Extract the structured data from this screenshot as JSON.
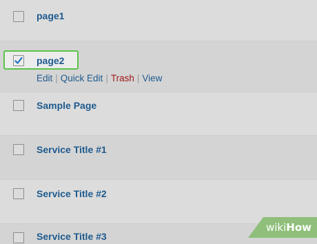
{
  "rows": [
    {
      "title": "page1",
      "checked": false
    },
    {
      "title": "page2",
      "checked": true
    },
    {
      "title": "Sample Page",
      "checked": false
    },
    {
      "title": "Service Title #1",
      "checked": false
    },
    {
      "title": "Service Title #2",
      "checked": false
    },
    {
      "title": "Service Title #3",
      "checked": false
    }
  ],
  "row_actions": {
    "edit": "Edit",
    "quick_edit": "Quick Edit",
    "trash": "Trash",
    "view": "View",
    "separator": "|"
  },
  "watermark": {
    "wiki": "wiki",
    "how": "How"
  },
  "colors": {
    "link": "#1e5a8e",
    "trash": "#a01919",
    "highlight_border": "#5bc24a",
    "watermark_bg": "#8fbf7a"
  }
}
